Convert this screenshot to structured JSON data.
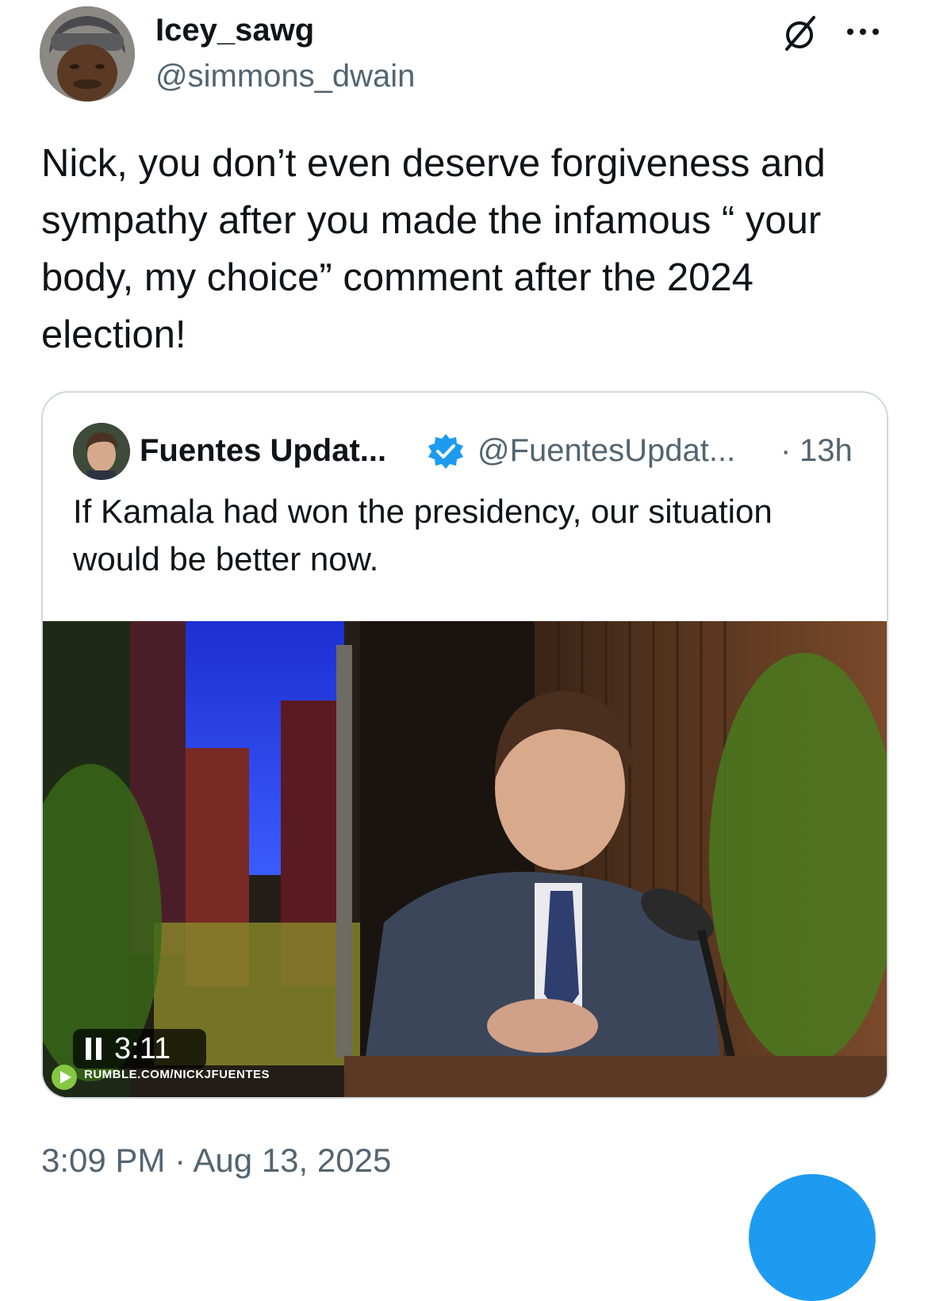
{
  "tweet": {
    "author": {
      "display_name": "Icey_sawg",
      "handle": "@simmons_dwain",
      "avatar_icon": "user-avatar"
    },
    "text": "Nick, you don’t even deserve forgiveness and\nsympathy after you made the infamous “ your\nbody, my choice” comment after the 2024\nelection!",
    "timestamp": "3:09 PM · Aug 13, 2025"
  },
  "quote": {
    "author": {
      "display_name": "Fuentes Updat...",
      "handle": "@FuentesUpdat...",
      "separator": "·",
      "time": "13h",
      "verified": true
    },
    "text": "If Kamala had won the presidency, our situation\nwould be better now.",
    "video": {
      "duration": "3:11",
      "playing": true,
      "watermark": "RUMBLE.COM/NICKJFUENTES"
    }
  },
  "colors": {
    "accent": "#1d9bf0",
    "text_primary": "#0f1419",
    "text_secondary": "#536471",
    "border": "#cfd9de"
  },
  "icons": [
    "mute-icon",
    "more-icon",
    "verified-badge-icon",
    "pause-icon",
    "rumble-logo-icon"
  ]
}
